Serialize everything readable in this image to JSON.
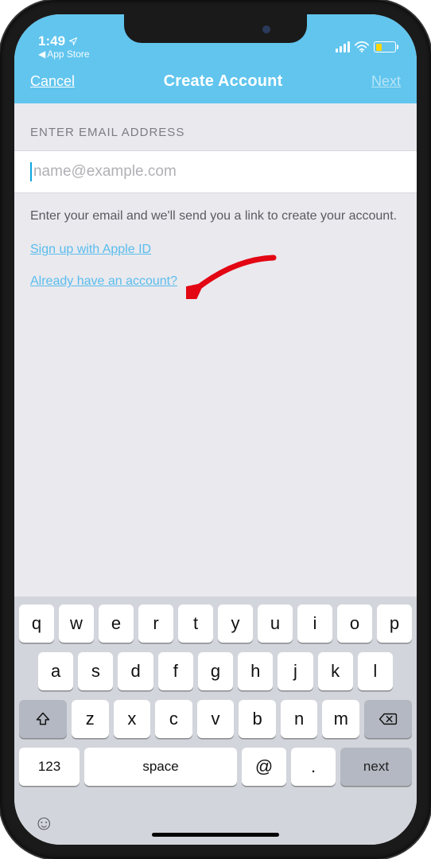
{
  "statusbar": {
    "time": "1:49",
    "back_app": "App Store"
  },
  "navbar": {
    "left": "Cancel",
    "title": "Create Account",
    "right": "Next"
  },
  "form": {
    "section_header": "ENTER EMAIL ADDRESS",
    "email_placeholder": "name@example.com",
    "email_value": "",
    "hint": "Enter your email and we'll send you a link to create your account.",
    "link_apple": "Sign up with Apple ID",
    "link_existing": "Already have an account?"
  },
  "keyboard": {
    "row1": [
      "q",
      "w",
      "e",
      "r",
      "t",
      "y",
      "u",
      "i",
      "o",
      "p"
    ],
    "row2": [
      "a",
      "s",
      "d",
      "f",
      "g",
      "h",
      "j",
      "k",
      "l"
    ],
    "row3": [
      "z",
      "x",
      "c",
      "v",
      "b",
      "n",
      "m"
    ],
    "num_key": "123",
    "space_key": "space",
    "at_key": "@",
    "dot_key": ".",
    "next_key": "next"
  }
}
